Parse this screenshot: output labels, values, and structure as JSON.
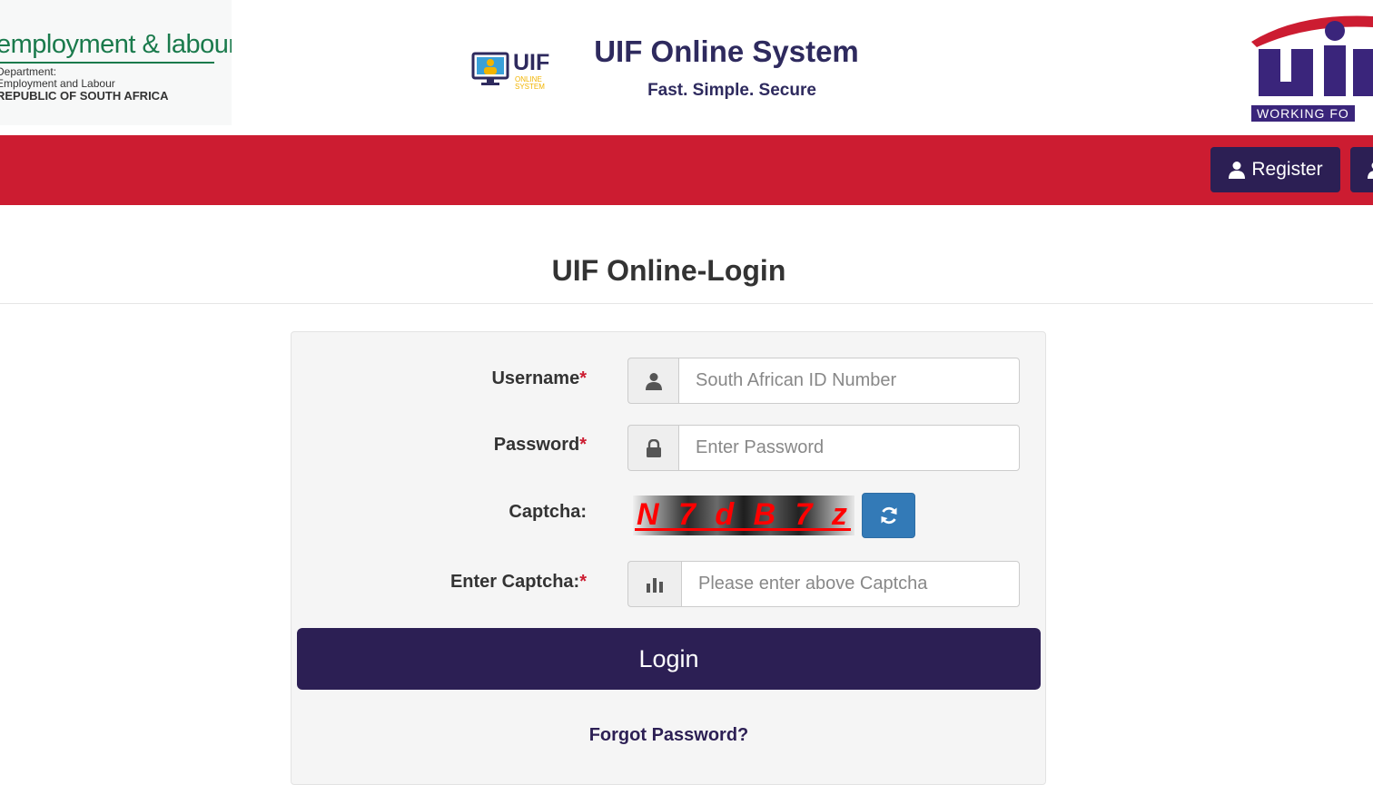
{
  "header": {
    "dept_logo": {
      "big_text": "employment & labour",
      "line1": "Department:",
      "line2": "Employment and Labour",
      "line3": "REPUBLIC OF SOUTH AFRICA"
    },
    "small_logo": {
      "word": "UIF",
      "sub1": "ONLINE",
      "sub2": "SYSTEM"
    },
    "title": "UIF Online System",
    "tagline": "Fast. Simple. Secure",
    "big_logo": {
      "working_text": "WORKING FO"
    }
  },
  "nav": {
    "register_label": "Register",
    "user_icon": "user-icon"
  },
  "page": {
    "title": "UIF Online-Login"
  },
  "form": {
    "username": {
      "label": "Username",
      "required_mark": "*",
      "placeholder": "South African ID Number",
      "value": "",
      "icon": "user-icon"
    },
    "password": {
      "label": "Password",
      "required_mark": "*",
      "placeholder": "Enter Password",
      "value": "",
      "icon": "lock-icon"
    },
    "captcha": {
      "label": "Captcha:",
      "image_text": "N 7 d B 7 z",
      "refresh_icon": "refresh-icon"
    },
    "enter_captcha": {
      "label": "Enter Captcha:",
      "required_mark": "*",
      "placeholder": "Please enter above Captcha",
      "value": "",
      "icon": "bar-chart-icon"
    },
    "login_label": "Login",
    "forgot_label": "Forgot Password?"
  },
  "colors": {
    "brand_navy": "#2c1f54",
    "brand_red": "#cc1c31",
    "refresh_blue": "#337ab7",
    "dept_green": "#1a7a4c"
  }
}
